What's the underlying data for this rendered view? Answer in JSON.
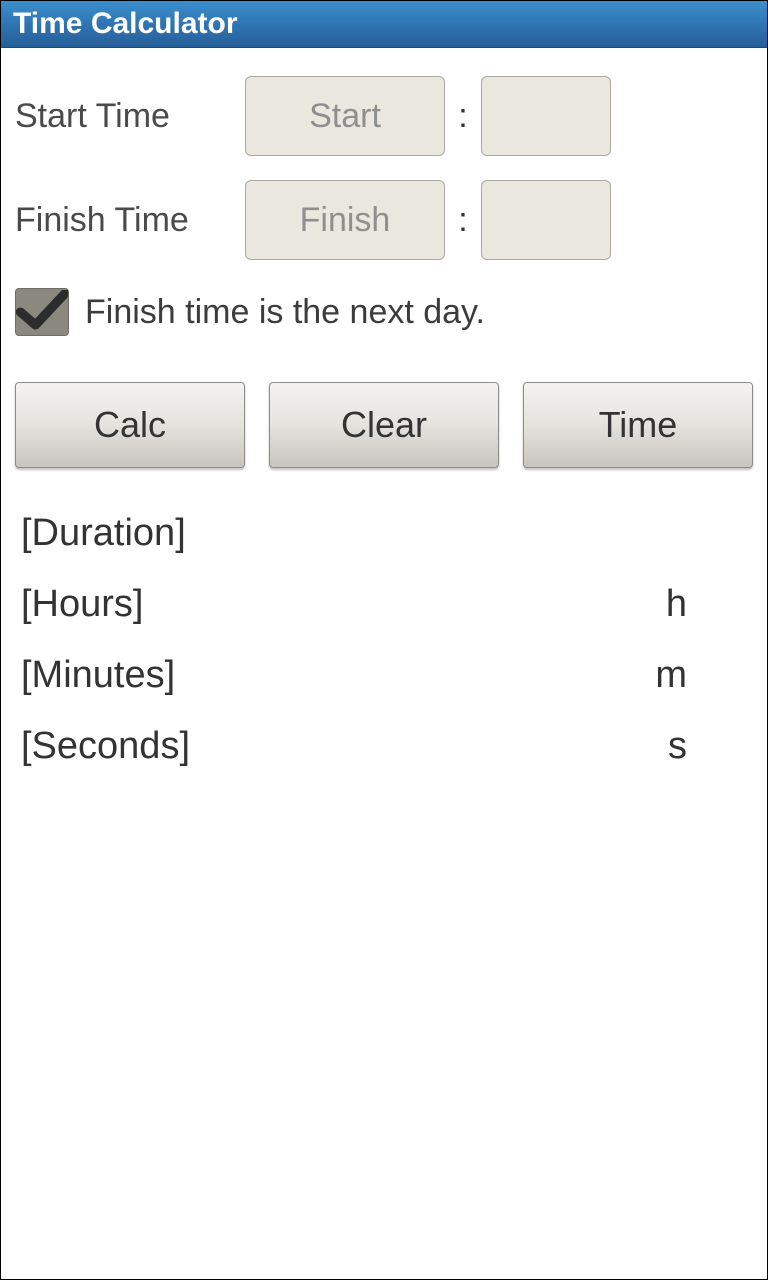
{
  "title": "Time Calculator",
  "inputs": {
    "start": {
      "label": "Start Time",
      "placeholder_hour": "Start",
      "placeholder_min": "",
      "value_hour": "",
      "value_min": ""
    },
    "finish": {
      "label": "Finish Time",
      "placeholder_hour": "Finish",
      "placeholder_min": "",
      "value_hour": "",
      "value_min": ""
    },
    "colon": ":"
  },
  "checkbox": {
    "label": "Finish time is the next day.",
    "checked": true
  },
  "buttons": {
    "calc": "Calc",
    "clear": "Clear",
    "time": "Time"
  },
  "results": {
    "duration_label": "[Duration]",
    "rows": [
      {
        "label": "[Hours]",
        "unit": "h"
      },
      {
        "label": "[Minutes]",
        "unit": "m"
      },
      {
        "label": "[Seconds]",
        "unit": "s"
      }
    ]
  }
}
